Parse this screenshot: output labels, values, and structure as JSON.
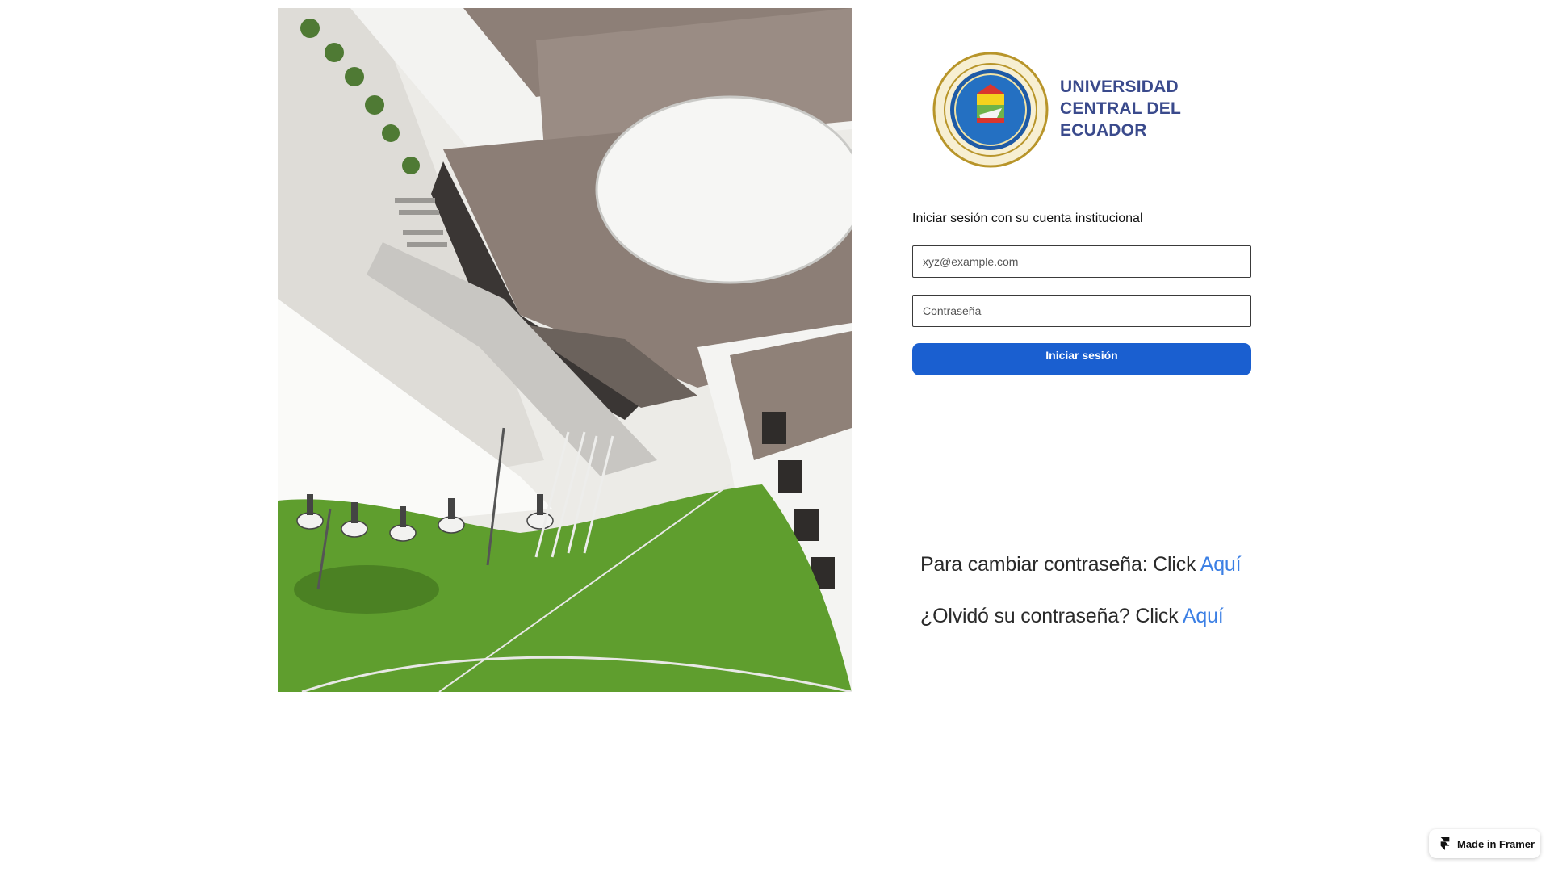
{
  "logo": {
    "lines": [
      "UNIVERSIDAD",
      "CENTRAL DEL",
      "ECUADOR"
    ],
    "seal_ring_text": "UNIVERSIDAD CENTRAL DEL ECUADOR",
    "seal_bottom_text": "QUITO"
  },
  "login": {
    "title": "Iniciar sesión con su cuenta institucional",
    "email_placeholder": "xyz@example.com",
    "password_placeholder": "Contraseña",
    "submit_label": "Iniciar sesión"
  },
  "links": {
    "change_password_text": "Para cambiar contraseña: Click ",
    "change_password_link": "Aquí",
    "forgot_password_text": "¿Olvidó su contraseña? Click ",
    "forgot_password_link": "Aquí"
  },
  "badge": {
    "label": "Made in Framer",
    "icon": "framer-logo-icon"
  },
  "colors": {
    "primary_button": "#1a5fd0",
    "link": "#3b7fe4",
    "logo_text": "#3a4a8c",
    "grass": "#5f9e2e"
  }
}
